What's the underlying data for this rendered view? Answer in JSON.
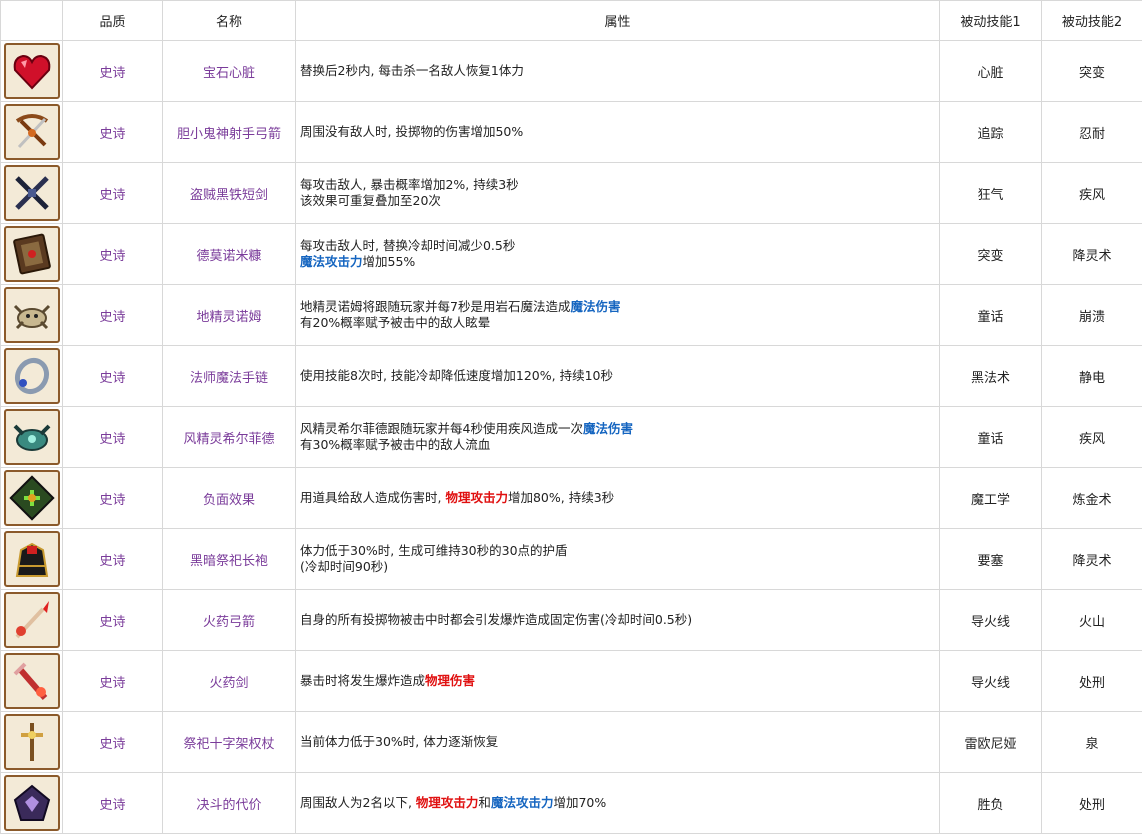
{
  "headers": [
    "",
    "品质",
    "名称",
    "属性",
    "被动技能1",
    "被动技能2"
  ],
  "rows": [
    {
      "icon": "gem-heart-icon",
      "quality": "史诗",
      "name": "宝石心脏",
      "attr": [
        [
          {
            "t": "替换后2秒内, 每击杀一名敌人恢复1体力"
          }
        ]
      ],
      "p1": "心脏",
      "p2": "突变"
    },
    {
      "icon": "crossbow-icon",
      "quality": "史诗",
      "name": "胆小鬼神射手弓箭",
      "attr": [
        [
          {
            "t": "周围没有敌人时, 投掷物的伤害增加50%"
          }
        ]
      ],
      "p1": "追踪",
      "p2": "忍耐"
    },
    {
      "icon": "black-dagger-icon",
      "quality": "史诗",
      "name": "盗贼黑铁短剑",
      "attr": [
        [
          {
            "t": "每攻击敌人, 暴击概率增加2%, 持续3秒"
          }
        ],
        [
          {
            "t": "该效果可重复叠加至20次"
          }
        ]
      ],
      "p1": "狂气",
      "p2": "疾风"
    },
    {
      "icon": "spellbook-icon",
      "quality": "史诗",
      "name": "德莫诺米糠",
      "attr": [
        [
          {
            "t": "每攻击敌人时, 替换冷却时间减少0.5秒"
          }
        ],
        [
          {
            "t": "魔法攻击力",
            "c": "blue"
          },
          {
            "t": "增加55%"
          }
        ]
      ],
      "p1": "突变",
      "p2": "降灵术"
    },
    {
      "icon": "crab-icon",
      "quality": "史诗",
      "name": "地精灵诺姆",
      "attr": [
        [
          {
            "t": "地精灵诺姆将跟随玩家并每7秒是用岩石魔法造成"
          },
          {
            "t": "魔法伤害",
            "c": "blue"
          }
        ],
        [
          {
            "t": "有20%概率赋予被击中的敌人眩晕"
          }
        ]
      ],
      "p1": "童话",
      "p2": "崩溃"
    },
    {
      "icon": "chain-bracelet-icon",
      "quality": "史诗",
      "name": "法师魔法手链",
      "attr": [
        [
          {
            "t": "使用技能8次时, 技能冷却降低速度增加120%, 持续10秒"
          }
        ]
      ],
      "p1": "黑法术",
      "p2": "静电"
    },
    {
      "icon": "wind-spirit-icon",
      "quality": "史诗",
      "name": "风精灵希尔菲德",
      "attr": [
        [
          {
            "t": "风精灵希尔菲德跟随玩家并每4秒使用疾风造成一次"
          },
          {
            "t": "魔法伤害",
            "c": "blue"
          }
        ],
        [
          {
            "t": "有30%概率赋予被击中的敌人流血"
          }
        ]
      ],
      "p1": "童话",
      "p2": "疾风"
    },
    {
      "icon": "green-rune-icon",
      "quality": "史诗",
      "name": "负面效果",
      "attr": [
        [
          {
            "t": "用道具给敌人造成伤害时, "
          },
          {
            "t": "物理攻击力",
            "c": "red"
          },
          {
            "t": "增加80%, 持续3秒"
          }
        ]
      ],
      "p1": "魔工学",
      "p2": "炼金术"
    },
    {
      "icon": "dark-robe-icon",
      "quality": "史诗",
      "name": "黑暗祭祀长袍",
      "attr": [
        [
          {
            "t": "体力低于30%时, 生成可维持30秒的30点的护盾"
          }
        ],
        [
          {
            "t": "(冷却时间90秒)"
          }
        ]
      ],
      "p1": "要塞",
      "p2": "降灵术"
    },
    {
      "icon": "fire-arrow-icon",
      "quality": "史诗",
      "name": "火药弓箭",
      "attr": [
        [
          {
            "t": "自身的所有投掷物被击中时都会引发爆炸造成固定伤害(冷却时间0.5秒)"
          }
        ]
      ],
      "p1": "导火线",
      "p2": "火山"
    },
    {
      "icon": "fire-sword-icon",
      "quality": "史诗",
      "name": "火药剑",
      "attr": [
        [
          {
            "t": "暴击时将发生爆炸造成"
          },
          {
            "t": "物理伤害",
            "c": "red"
          }
        ]
      ],
      "p1": "导火线",
      "p2": "处刑"
    },
    {
      "icon": "cross-staff-icon",
      "quality": "史诗",
      "name": "祭祀十字架权杖",
      "attr": [
        [
          {
            "t": "当前体力低于30%时, 体力逐渐恢复"
          }
        ]
      ],
      "p1": "雷欧尼娅",
      "p2": "泉"
    },
    {
      "icon": "purple-armor-icon",
      "quality": "史诗",
      "name": "决斗的代价",
      "attr": [
        [
          {
            "t": "周围敌人为2名以下, "
          },
          {
            "t": "物理攻击力",
            "c": "red"
          },
          {
            "t": "和"
          },
          {
            "t": "魔法攻击力",
            "c": "blue"
          },
          {
            "t": "增加70%"
          }
        ]
      ],
      "p1": "胜负",
      "p2": "处刑"
    }
  ],
  "colors": {
    "quality": "#7a3b9a",
    "blue": "#1565c0",
    "red": "#e01010",
    "border": "#d8d8d8"
  }
}
